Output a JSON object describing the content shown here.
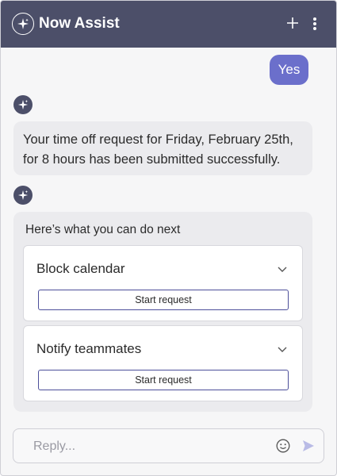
{
  "header": {
    "title": "Now Assist",
    "logo_icon": "sparkle-icon",
    "new_chat_icon": "plus-icon",
    "menu_icon": "kebab-menu-icon",
    "background_color": "#4c4f69"
  },
  "messages": {
    "user_reply": "Yes",
    "bot_message": "Your time off request for Friday, February 25th, for 8 hours has been submitted successfully.",
    "next_steps_title": "Here’s what you can do next",
    "options": [
      {
        "label": "Block calendar",
        "button_label": "Start request"
      },
      {
        "label": "Notify teammates",
        "button_label": "Start request"
      }
    ]
  },
  "composer": {
    "placeholder": "Reply...",
    "emoji_icon": "smiley-icon",
    "send_icon": "send-icon"
  },
  "colors": {
    "accent": "#6b6fcb",
    "bubble": "#ebebee"
  }
}
